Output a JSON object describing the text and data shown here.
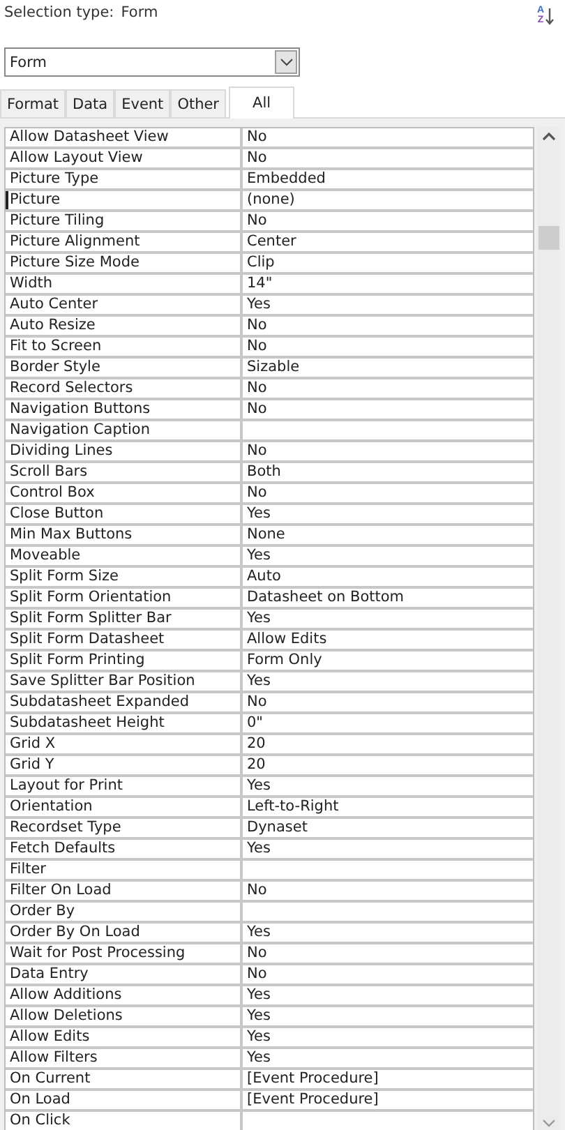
{
  "selection_type": {
    "label": "Selection type:",
    "value": "Form"
  },
  "sort_button": {
    "top": "A",
    "bottom": "Z"
  },
  "object_dropdown": {
    "value": "Form"
  },
  "tabs": [
    {
      "label": "Format",
      "selected": false
    },
    {
      "label": "Data",
      "selected": false
    },
    {
      "label": "Event",
      "selected": false
    },
    {
      "label": "Other",
      "selected": false
    },
    {
      "label": "All",
      "selected": true
    }
  ],
  "properties": [
    {
      "name": "Allow Datasheet View",
      "value": "No",
      "selected": false
    },
    {
      "name": "Allow Layout View",
      "value": "No",
      "selected": false
    },
    {
      "name": "Picture Type",
      "value": "Embedded",
      "selected": false
    },
    {
      "name": "Picture",
      "value": "(none)",
      "selected": true
    },
    {
      "name": "Picture Tiling",
      "value": "No",
      "selected": false
    },
    {
      "name": "Picture Alignment",
      "value": "Center",
      "selected": false
    },
    {
      "name": "Picture Size Mode",
      "value": "Clip",
      "selected": false
    },
    {
      "name": "Width",
      "value": "14\"",
      "selected": false
    },
    {
      "name": "Auto Center",
      "value": "Yes",
      "selected": false
    },
    {
      "name": "Auto Resize",
      "value": "No",
      "selected": false
    },
    {
      "name": "Fit to Screen",
      "value": "No",
      "selected": false
    },
    {
      "name": "Border Style",
      "value": "Sizable",
      "selected": false
    },
    {
      "name": "Record Selectors",
      "value": "No",
      "selected": false
    },
    {
      "name": "Navigation Buttons",
      "value": "No",
      "selected": false
    },
    {
      "name": "Navigation Caption",
      "selected": false
    },
    {
      "name": "Dividing Lines",
      "value": "No",
      "selected": false
    },
    {
      "name": "Scroll Bars",
      "value": "Both",
      "selected": false
    },
    {
      "name": "Control Box",
      "value": "No",
      "selected": false
    },
    {
      "name": "Close Button",
      "value": "Yes",
      "selected": false
    },
    {
      "name": "Min Max Buttons",
      "value": "None",
      "selected": false
    },
    {
      "name": "Moveable",
      "value": "Yes",
      "selected": false
    },
    {
      "name": "Split Form Size",
      "value": "Auto",
      "selected": false
    },
    {
      "name": "Split Form Orientation",
      "value": "Datasheet on Bottom",
      "selected": false
    },
    {
      "name": "Split Form Splitter Bar",
      "value": "Yes",
      "selected": false
    },
    {
      "name": "Split Form Datasheet",
      "value": "Allow Edits",
      "selected": false
    },
    {
      "name": "Split Form Printing",
      "value": "Form Only",
      "selected": false
    },
    {
      "name": "Save Splitter Bar Position",
      "value": "Yes",
      "selected": false
    },
    {
      "name": "Subdatasheet Expanded",
      "value": "No",
      "selected": false
    },
    {
      "name": "Subdatasheet Height",
      "value": "0\"",
      "selected": false
    },
    {
      "name": "Grid X",
      "value": "20",
      "selected": false
    },
    {
      "name": "Grid Y",
      "value": "20",
      "selected": false
    },
    {
      "name": "Layout for Print",
      "value": "Yes",
      "selected": false
    },
    {
      "name": "Orientation",
      "value": "Left-to-Right",
      "selected": false
    },
    {
      "name": "Recordset Type",
      "value": "Dynaset",
      "selected": false
    },
    {
      "name": "Fetch Defaults",
      "value": "Yes",
      "selected": false
    },
    {
      "name": "Filter",
      "selected": false
    },
    {
      "name": "Filter On Load",
      "value": "No",
      "selected": false
    },
    {
      "name": "Order By",
      "selected": false
    },
    {
      "name": "Order By On Load",
      "value": "Yes",
      "selected": false
    },
    {
      "name": "Wait for Post Processing",
      "value": "No",
      "selected": false
    },
    {
      "name": "Data Entry",
      "value": "No",
      "selected": false
    },
    {
      "name": "Allow Additions",
      "value": "Yes",
      "selected": false
    },
    {
      "name": "Allow Deletions",
      "value": "Yes",
      "selected": false
    },
    {
      "name": "Allow Edits",
      "value": "Yes",
      "selected": false
    },
    {
      "name": "Allow Filters",
      "value": "Yes",
      "selected": false
    },
    {
      "name": "On Current",
      "value": "[Event Procedure]",
      "selected": false
    },
    {
      "name": "On Load",
      "value": "[Event Procedure]",
      "selected": false
    },
    {
      "name": "On Click",
      "selected": false
    }
  ]
}
